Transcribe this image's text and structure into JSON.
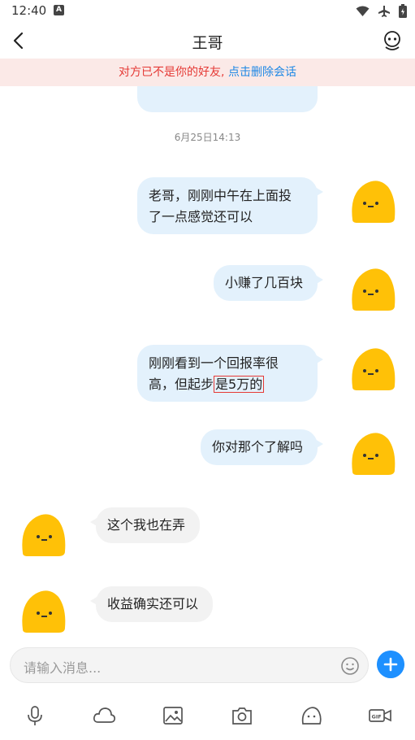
{
  "status": {
    "time": "12:40",
    "badge": "A"
  },
  "header": {
    "title": "王哥"
  },
  "notice": {
    "text": "对方已不是你的好友,",
    "link": "点击删除会话"
  },
  "timestamp": "6月25日14:13",
  "messages": [
    {
      "side": "right",
      "line1": "老哥，刚刚中午在上面投",
      "line2": "了一点感觉还可以"
    },
    {
      "side": "right",
      "text": "小赚了几百块"
    },
    {
      "side": "right",
      "line1": "刚刚看到一个回报率很",
      "line2_pre": "高，但起步",
      "line2_hl": "是5万的"
    },
    {
      "side": "right",
      "text": "你对那个了解吗"
    },
    {
      "side": "left",
      "text": "这个我也在弄"
    },
    {
      "side": "left",
      "text": "收益确实还可以"
    }
  ],
  "input": {
    "placeholder": "请输入消息..."
  },
  "toolbar": {
    "icons": [
      "mic-icon",
      "cloud-icon",
      "image-icon",
      "camera-icon",
      "emoji-icon",
      "gif-video-icon"
    ]
  },
  "colors": {
    "accent": "#1e90ff",
    "bubble_self": "#e3f1fc",
    "bubble_other": "#f2f2f2",
    "notice_bg": "#fbe9e7",
    "warning": "#e53935",
    "avatar": "#ffc107"
  }
}
